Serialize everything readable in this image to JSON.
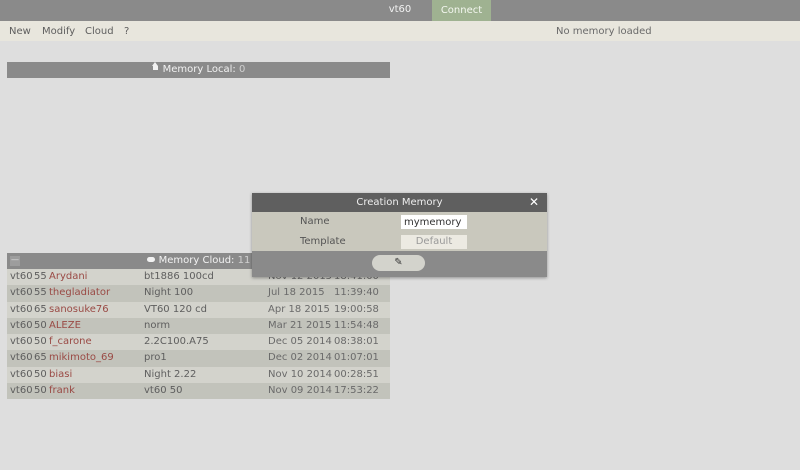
{
  "titlebar": {
    "title": "vt60",
    "connect_label": "Connect"
  },
  "menu": {
    "new": "New",
    "modify": "Modify",
    "cloud": "Cloud",
    "help": "?",
    "status": "No memory loaded"
  },
  "memory_local": {
    "label": "Memory Local:",
    "count": "0"
  },
  "memory_cloud": {
    "label": "Memory Cloud:",
    "count": "11",
    "collapse": "—"
  },
  "cloud_rows": [
    {
      "model": "vt60",
      "size": "55",
      "user": "Arydani",
      "preset": "bt1886 100cd",
      "date": "Nov 12 2015",
      "time": "18:41:00"
    },
    {
      "model": "vt60",
      "size": "55",
      "user": "thegladiator",
      "preset": "Night 100",
      "date": "Jul 18 2015",
      "time": "11:39:40"
    },
    {
      "model": "vt60",
      "size": "65",
      "user": "sanosuke76",
      "preset": "VT60 120 cd",
      "date": "Apr 18 2015",
      "time": "19:00:58"
    },
    {
      "model": "vt60",
      "size": "50",
      "user": "ALEZE",
      "preset": "norm",
      "date": "Mar 21 2015",
      "time": "11:54:48"
    },
    {
      "model": "vt60",
      "size": "50",
      "user": "f_carone",
      "preset": "2.2C100.A75",
      "date": "Dec 05 2014",
      "time": "08:38:01"
    },
    {
      "model": "vt60",
      "size": "65",
      "user": "mikimoto_69",
      "preset": "pro1",
      "date": "Dec 02 2014",
      "time": "01:07:01"
    },
    {
      "model": "vt60",
      "size": "50",
      "user": "biasi",
      "preset": "Night 2.22",
      "date": "Nov 10 2014",
      "time": "00:28:51"
    },
    {
      "model": "vt60",
      "size": "50",
      "user": "frank",
      "preset": "vt60 50",
      "date": "Nov 09 2014",
      "time": "17:53:22"
    }
  ],
  "dialog": {
    "title": "Creation Memory",
    "close_glyph": "✕",
    "name_label": "Name",
    "name_value": "mymemory",
    "template_label": "Template",
    "template_value": "Default",
    "confirm_icon": "pencil-icon",
    "confirm_glyph": "✎"
  }
}
